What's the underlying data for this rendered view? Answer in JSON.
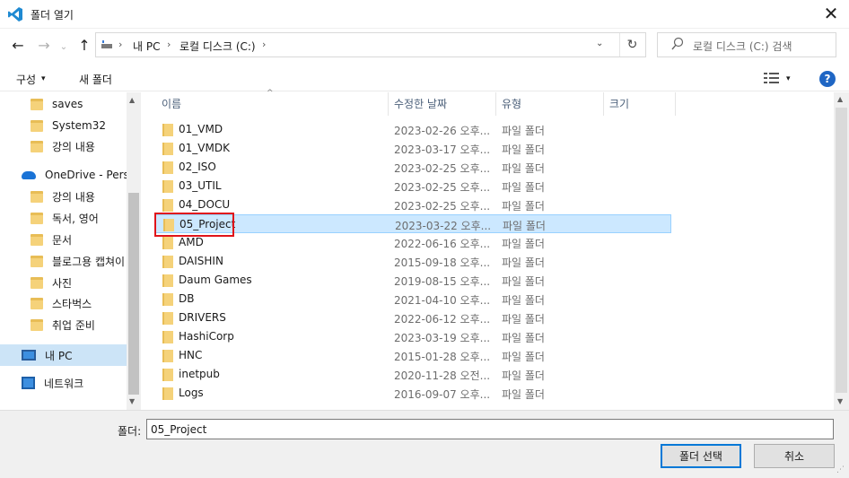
{
  "window": {
    "title": "폴더 열기",
    "close_glyph": "✕"
  },
  "nav_buttons": {
    "back": "←",
    "forward": "→",
    "recent": "⌄",
    "up": "↑"
  },
  "address": {
    "crumbs": [
      "내 PC",
      "로컬 디스크 (C:)"
    ],
    "sep": "›",
    "dropdown": "⌄",
    "refresh": "↻"
  },
  "search": {
    "placeholder": "로컬 디스크 (C:) 검색"
  },
  "toolbar": {
    "organize": "구성",
    "organize_arrow": "▾",
    "new_folder": "새 폴더",
    "view_arrow": "▾",
    "help": "?"
  },
  "nav": {
    "items": [
      {
        "label": "saves",
        "icon": "folder-icon",
        "indent": 1
      },
      {
        "label": "System32",
        "icon": "folder-icon",
        "indent": 1
      },
      {
        "label": "강의 내용",
        "icon": "folder-icon",
        "indent": 1
      },
      {
        "label": "OneDrive - Persor",
        "icon": "onedrive-icon",
        "indent": 0
      },
      {
        "label": "강의 내용",
        "icon": "folder-icon",
        "indent": 1
      },
      {
        "label": "독서, 영어",
        "icon": "folder-icon",
        "indent": 1
      },
      {
        "label": "문서",
        "icon": "folder-icon",
        "indent": 1
      },
      {
        "label": "블로그용 캡쳐이",
        "icon": "folder-icon",
        "indent": 1
      },
      {
        "label": "사진",
        "icon": "folder-icon",
        "indent": 1
      },
      {
        "label": "스타벅스",
        "icon": "folder-icon",
        "indent": 1
      },
      {
        "label": "취업 준비",
        "icon": "folder-icon",
        "indent": 1
      },
      {
        "label": "내 PC",
        "icon": "pc-icon",
        "indent": 0,
        "selected": true
      },
      {
        "label": "네트워크",
        "icon": "network-icon",
        "indent": 0
      }
    ]
  },
  "columns": {
    "name": "이름",
    "date": "수정한 날짜",
    "type": "유형",
    "size": "크기"
  },
  "files": [
    {
      "name": "01_VMD",
      "date": "2023-02-26 오후...",
      "type": "파일 폴더"
    },
    {
      "name": "01_VMDK",
      "date": "2023-03-17 오후...",
      "type": "파일 폴더"
    },
    {
      "name": "02_ISO",
      "date": "2023-02-25 오후...",
      "type": "파일 폴더"
    },
    {
      "name": "03_UTIL",
      "date": "2023-02-25 오후...",
      "type": "파일 폴더"
    },
    {
      "name": "04_DOCU",
      "date": "2023-02-25 오후...",
      "type": "파일 폴더"
    },
    {
      "name": "05_Project",
      "date": "2023-03-22 오후...",
      "type": "파일 폴더",
      "selected": true
    },
    {
      "name": "AMD",
      "date": "2022-06-16 오후...",
      "type": "파일 폴더"
    },
    {
      "name": "DAISHIN",
      "date": "2015-09-18 오후...",
      "type": "파일 폴더"
    },
    {
      "name": "Daum Games",
      "date": "2019-08-15 오후...",
      "type": "파일 폴더"
    },
    {
      "name": "DB",
      "date": "2021-04-10 오후...",
      "type": "파일 폴더"
    },
    {
      "name": "DRIVERS",
      "date": "2022-06-12 오후...",
      "type": "파일 폴더"
    },
    {
      "name": "HashiCorp",
      "date": "2023-03-19 오후...",
      "type": "파일 폴더"
    },
    {
      "name": "HNC",
      "date": "2015-01-28 오후...",
      "type": "파일 폴더"
    },
    {
      "name": "inetpub",
      "date": "2020-11-28 오전...",
      "type": "파일 폴더"
    },
    {
      "name": "Logs",
      "date": "2016-09-07 오후...",
      "type": "파일 폴더"
    }
  ],
  "scroll": {
    "up": "▲",
    "down": "▼",
    "sort": "^"
  },
  "bottom": {
    "folder_label": "폴더:",
    "folder_value": "05_Project",
    "select_button": "폴더 선택",
    "cancel_button": "취소",
    "grip": "⋰"
  },
  "colors": {
    "accent": "#0078d7",
    "selection": "#cce8ff",
    "highlight": "#e0141a",
    "folder": "#f5d27a"
  }
}
